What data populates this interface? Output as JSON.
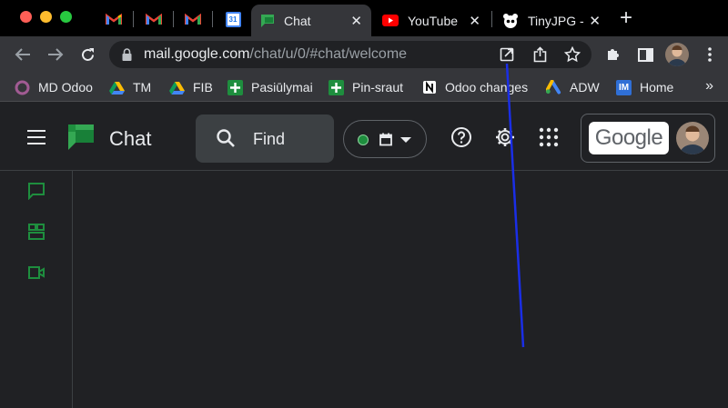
{
  "browser": {
    "tabs": [
      {
        "kind": "pinned",
        "icon": "gmail-icon"
      },
      {
        "kind": "pinned",
        "icon": "gmail-icon"
      },
      {
        "kind": "pinned",
        "icon": "gmail-icon"
      },
      {
        "kind": "pinned",
        "icon": "google-calendar-icon",
        "text": "31"
      },
      {
        "kind": "tab",
        "title": "Chat",
        "icon": "google-chat-icon",
        "active": true
      },
      {
        "kind": "tab",
        "title": "YouTube",
        "icon": "youtube-icon"
      },
      {
        "kind": "tab",
        "title": "TinyJPG -",
        "icon": "panda-icon"
      }
    ],
    "new_tab": "+",
    "close_glyph": "✕",
    "url_host": "mail.google.com",
    "url_path": "/chat/u/0/#chat/welcome",
    "bookmarks": [
      {
        "label": "MD Odoo",
        "icon": "odoo-icon"
      },
      {
        "label": "TM",
        "icon": "google-drive-icon"
      },
      {
        "label": "FIB",
        "icon": "google-drive-icon"
      },
      {
        "label": "Pasiūlymai",
        "icon": "google-sheets-icon"
      },
      {
        "label": "Pin-sraut",
        "icon": "google-sheets-icon"
      },
      {
        "label": "Odoo changes",
        "icon": "notion-icon"
      },
      {
        "label": "ADW",
        "icon": "google-ads-icon"
      },
      {
        "label": "Home",
        "icon": "im-icon",
        "text": "IM"
      }
    ],
    "bookmarks_more": "»"
  },
  "app": {
    "title": "Chat",
    "search_placeholder": "Find",
    "google_label": "Google",
    "colors": {
      "accent": "#1e8e3e",
      "annotation": "#1a2ee6"
    }
  }
}
